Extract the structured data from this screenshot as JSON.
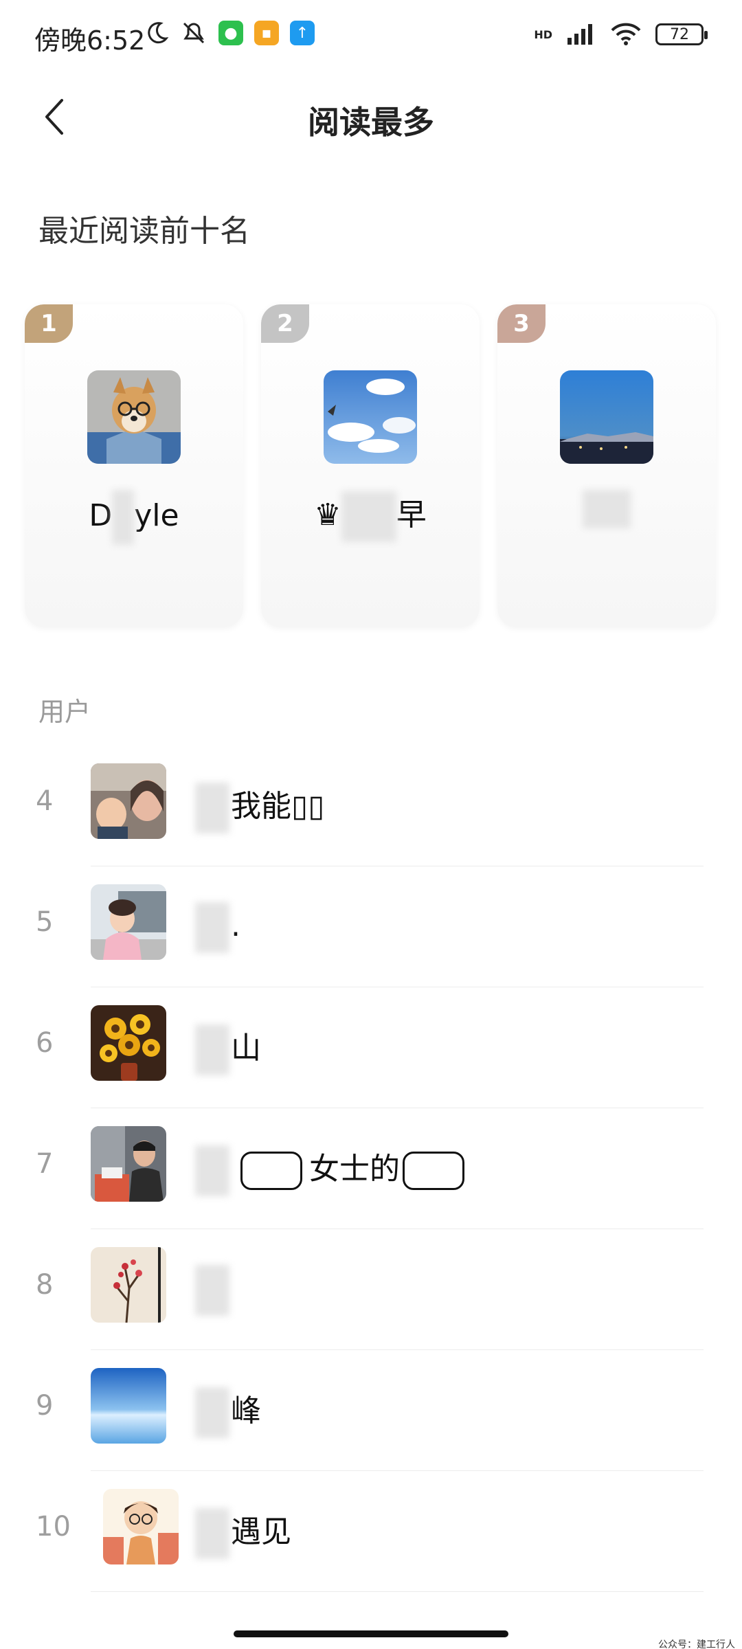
{
  "status_bar": {
    "time": "傍晚6:52",
    "network": "HD",
    "battery": "72"
  },
  "header": {
    "title": "阅读最多"
  },
  "top_section": {
    "title": "最近阅读前十名",
    "cards": [
      {
        "rank": "1",
        "name_prefix": "D",
        "name_suffix": "yle",
        "badge_color": "#c2a37a"
      },
      {
        "rank": "2",
        "name_prefix": "♛",
        "name_suffix": "早",
        "badge_color": "#c4c4c4"
      },
      {
        "rank": "3",
        "name_prefix": "",
        "name_suffix": "",
        "badge_color": "#c9a698"
      }
    ]
  },
  "users_section": {
    "label": "用户",
    "items": [
      {
        "rank": "4",
        "name": "我能▯▯"
      },
      {
        "rank": "5",
        "name": "."
      },
      {
        "rank": "6",
        "name": "山"
      },
      {
        "rank": "7",
        "name": "女士的"
      },
      {
        "rank": "8",
        "name": ""
      },
      {
        "rank": "9",
        "name": "峰"
      },
      {
        "rank": "10",
        "name": "遇见"
      }
    ]
  },
  "watermark": "公众号：建工行人"
}
